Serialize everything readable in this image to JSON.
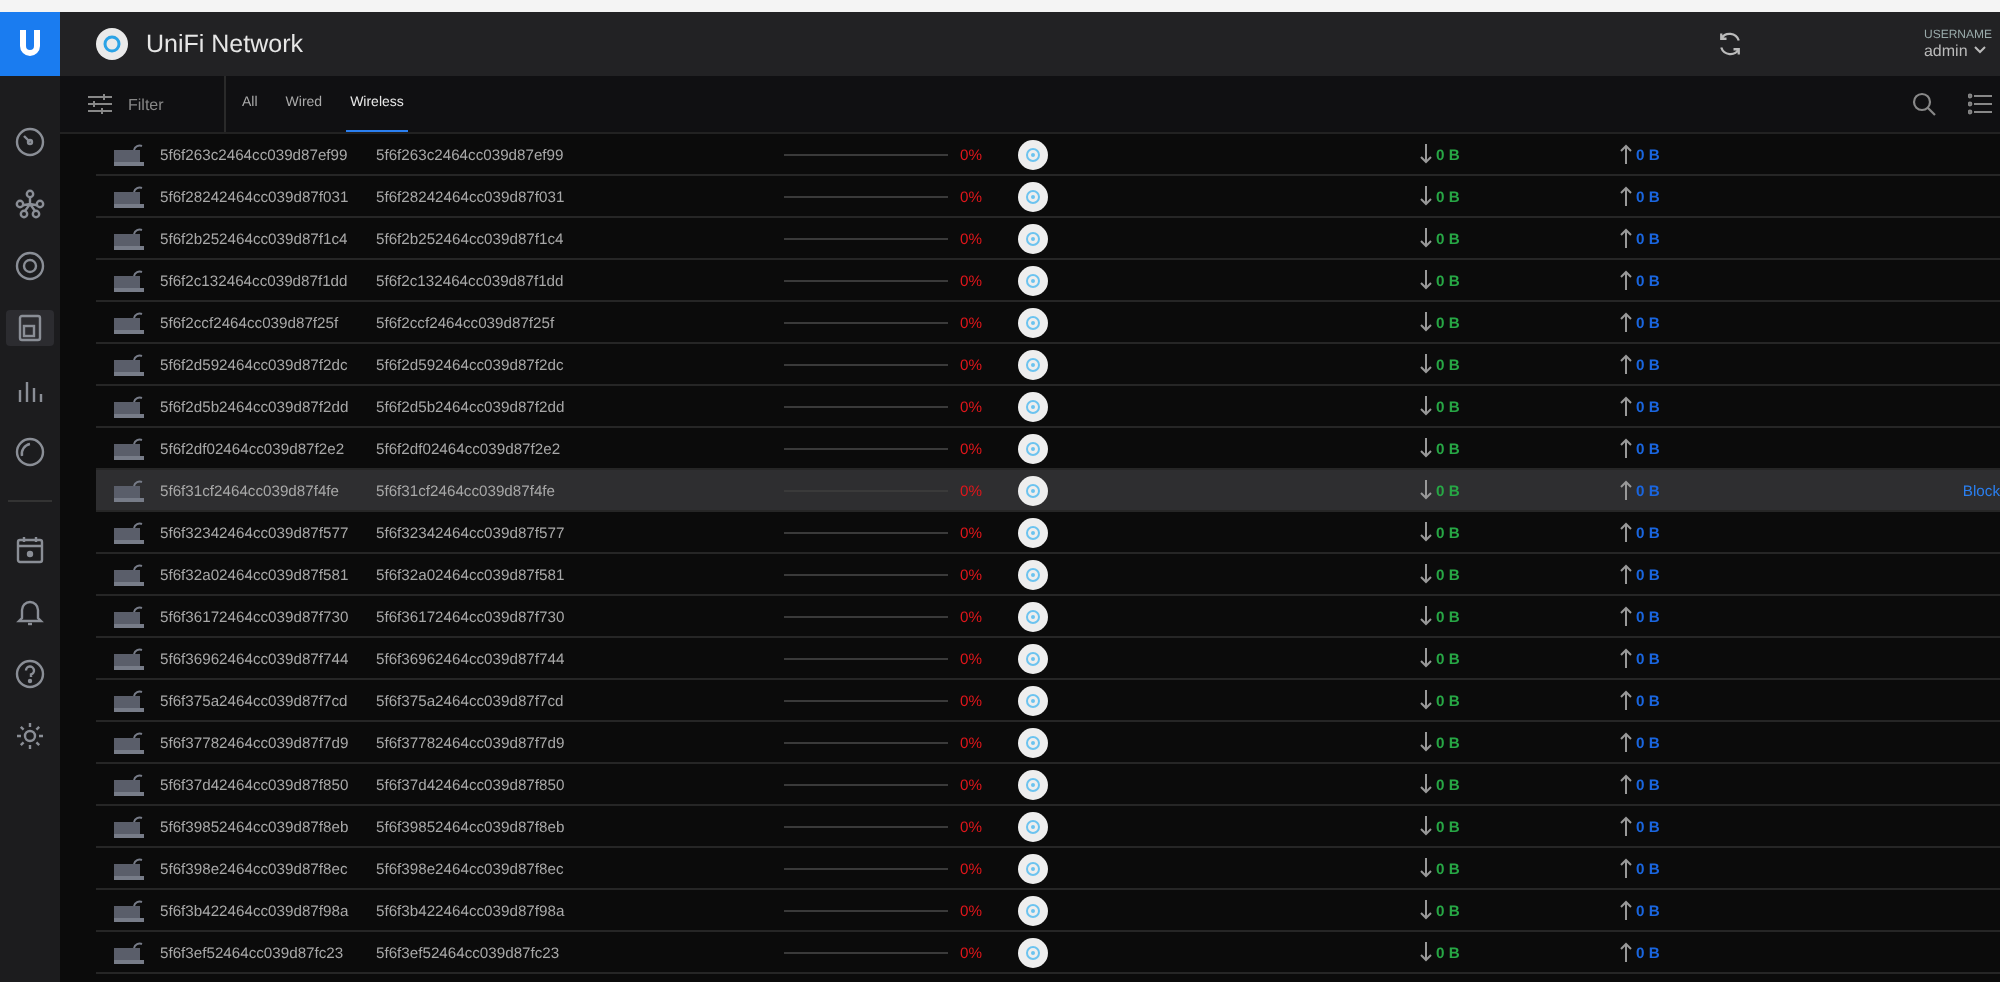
{
  "header": {
    "title": "UniFi Network",
    "username_label": "USERNAME",
    "username": "admin"
  },
  "sidebar": {
    "items": [
      {
        "kind": "gauge",
        "selected": false
      },
      {
        "kind": "nodes",
        "selected": false
      },
      {
        "kind": "target",
        "selected": false
      },
      {
        "kind": "clients",
        "selected": true
      },
      {
        "kind": "stats",
        "selected": false
      },
      {
        "kind": "ring",
        "selected": false
      },
      {
        "kind": "calendar",
        "selected": false
      },
      {
        "kind": "bell",
        "selected": false
      },
      {
        "kind": "help",
        "selected": false
      },
      {
        "kind": "settings",
        "selected": false
      }
    ]
  },
  "filter_bar": {
    "filter_label": "Filter",
    "tabs": [
      {
        "label": "All",
        "selected": false
      },
      {
        "label": "Wired",
        "selected": false
      },
      {
        "label": "Wireless",
        "selected": true
      }
    ]
  },
  "table": {
    "rows": [
      {
        "name": "5f6f263c2464cc039d87ef99",
        "column_2": "5f6f263c2464cc039d87ef99",
        "level": 0,
        "percent": "0%",
        "down": "0 B",
        "up": "0 B",
        "selected": false
      },
      {
        "name": "5f6f28242464cc039d87f031",
        "column_2": "5f6f28242464cc039d87f031",
        "level": 0,
        "percent": "0%",
        "down": "0 B",
        "up": "0 B",
        "selected": false
      },
      {
        "name": "5f6f2b252464cc039d87f1c4",
        "column_2": "5f6f2b252464cc039d87f1c4",
        "level": 0,
        "percent": "0%",
        "down": "0 B",
        "up": "0 B",
        "selected": false
      },
      {
        "name": "5f6f2c132464cc039d87f1dd",
        "column_2": "5f6f2c132464cc039d87f1dd",
        "level": 0,
        "percent": "0%",
        "down": "0 B",
        "up": "0 B",
        "selected": false
      },
      {
        "name": "5f6f2ccf2464cc039d87f25f",
        "column_2": "5f6f2ccf2464cc039d87f25f",
        "level": 0,
        "percent": "0%",
        "down": "0 B",
        "up": "0 B",
        "selected": false
      },
      {
        "name": "5f6f2d592464cc039d87f2dc",
        "column_2": "5f6f2d592464cc039d87f2dc",
        "level": 0,
        "percent": "0%",
        "down": "0 B",
        "up": "0 B",
        "selected": false
      },
      {
        "name": "5f6f2d5b2464cc039d87f2dd",
        "column_2": "5f6f2d5b2464cc039d87f2dd",
        "level": 0,
        "percent": "0%",
        "down": "0 B",
        "up": "0 B",
        "selected": false
      },
      {
        "name": "5f6f2df02464cc039d87f2e2",
        "column_2": "5f6f2df02464cc039d87f2e2",
        "level": 0,
        "percent": "0%",
        "down": "0 B",
        "up": "0 B",
        "selected": false
      },
      {
        "name": "5f6f31cf2464cc039d87f4fe",
        "column_2": "5f6f31cf2464cc039d87f4fe",
        "level": 0,
        "percent": "0%",
        "down": "0 B",
        "up": "0 B",
        "selected": true,
        "action": "Block"
      },
      {
        "name": "5f6f32342464cc039d87f577",
        "column_2": "5f6f32342464cc039d87f577",
        "level": 0,
        "percent": "0%",
        "down": "0 B",
        "up": "0 B",
        "selected": false
      },
      {
        "name": "5f6f32a02464cc039d87f581",
        "column_2": "5f6f32a02464cc039d87f581",
        "level": 0,
        "percent": "0%",
        "down": "0 B",
        "up": "0 B",
        "selected": false
      },
      {
        "name": "5f6f36172464cc039d87f730",
        "column_2": "5f6f36172464cc039d87f730",
        "level": 0,
        "percent": "0%",
        "down": "0 B",
        "up": "0 B",
        "selected": false
      },
      {
        "name": "5f6f36962464cc039d87f744",
        "column_2": "5f6f36962464cc039d87f744",
        "level": 0,
        "percent": "0%",
        "down": "0 B",
        "up": "0 B",
        "selected": false
      },
      {
        "name": "5f6f375a2464cc039d87f7cd",
        "column_2": "5f6f375a2464cc039d87f7cd",
        "level": 0,
        "percent": "0%",
        "down": "0 B",
        "up": "0 B",
        "selected": false
      },
      {
        "name": "5f6f37782464cc039d87f7d9",
        "column_2": "5f6f37782464cc039d87f7d9",
        "level": 0,
        "percent": "0%",
        "down": "0 B",
        "up": "0 B",
        "selected": false
      },
      {
        "name": "5f6f37d42464cc039d87f850",
        "column_2": "5f6f37d42464cc039d87f850",
        "level": 0,
        "percent": "0%",
        "down": "0 B",
        "up": "0 B",
        "selected": false
      },
      {
        "name": "5f6f39852464cc039d87f8eb",
        "column_2": "5f6f39852464cc039d87f8eb",
        "level": 0,
        "percent": "0%",
        "down": "0 B",
        "up": "0 B",
        "selected": false
      },
      {
        "name": "5f6f398e2464cc039d87f8ec",
        "column_2": "5f6f398e2464cc039d87f8ec",
        "level": 0,
        "percent": "0%",
        "down": "0 B",
        "up": "0 B",
        "selected": false
      },
      {
        "name": "5f6f3b422464cc039d87f98a",
        "column_2": "5f6f3b422464cc039d87f98a",
        "level": 0,
        "percent": "0%",
        "down": "0 B",
        "up": "0 B",
        "selected": false
      },
      {
        "name": "5f6f3ef52464cc039d87fc23",
        "column_2": "5f6f3ef52464cc039d87fc23",
        "level": 0,
        "percent": "0%",
        "down": "0 B",
        "up": "0 B",
        "selected": false
      }
    ]
  }
}
